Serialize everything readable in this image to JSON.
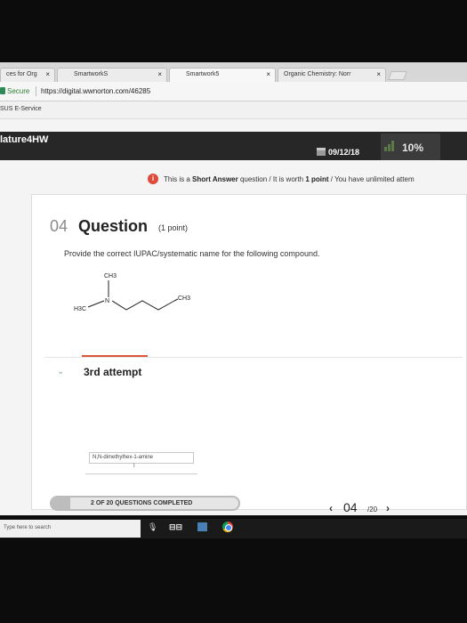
{
  "browser": {
    "tabs": [
      {
        "title": "ces for Org",
        "close": "×"
      },
      {
        "title": "SmartworkS",
        "close": "×"
      },
      {
        "title": "Smartwork5",
        "close": "×"
      },
      {
        "title": "Organic Chemistry: Norr",
        "close": "×"
      }
    ],
    "secure_label": "Secure",
    "url": "https://digital.wwnorton.com/46285",
    "bookmark": "SUS E-Service"
  },
  "header": {
    "app_name": "lature4HW",
    "due_date": "09/12/18",
    "score": "10%"
  },
  "notice": {
    "prefix": "This is a ",
    "type": "Short Answer",
    "middle": " question / It is worth ",
    "points": "1 point",
    "suffix": " / You have unlimited attem"
  },
  "question": {
    "number": "04",
    "word": "Question",
    "points": "(1 point)",
    "prompt": "Provide the correct IUPAC/systematic name for the following compound."
  },
  "molecule": {
    "top_methyl": "CH3",
    "left_methyl": "H3C",
    "nitrogen": "N",
    "end_methyl": "CH3"
  },
  "attempt": {
    "label": "3rd attempt",
    "answer_value": "N,N-dimethylhex-1-amine",
    "caret": "I"
  },
  "progress": {
    "label": "2 OF 20 QUESTIONS COMPLETED",
    "fraction": 0.1
  },
  "navigation": {
    "prev": "‹",
    "current": "04",
    "total": "/20",
    "next": "›"
  },
  "taskbar": {
    "search_placeholder": "Type here to search",
    "task_view": "⊟⊟"
  },
  "colors": {
    "header_bg": "#272727",
    "accent_red": "#e2553d",
    "info_red": "#e04a3a"
  }
}
